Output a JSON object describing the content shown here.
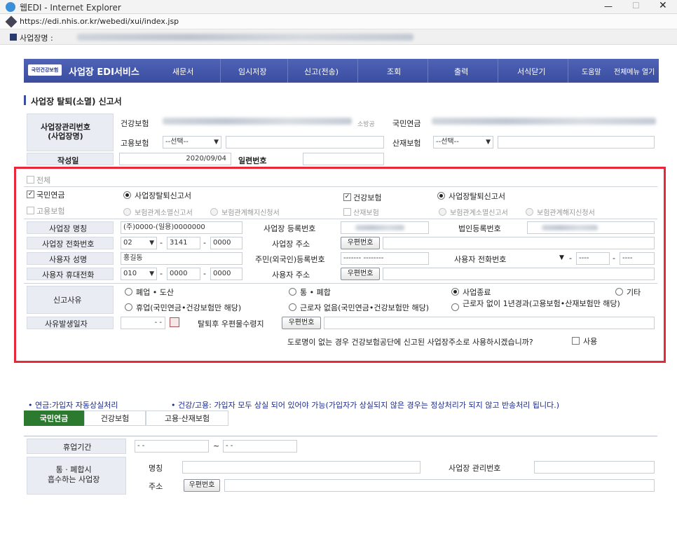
{
  "window": {
    "title": "웹EDI - Internet Explorer",
    "url": "https://edi.nhis.or.kr/webedi/xui/index.jsp"
  },
  "bizbar": {
    "label": "사업장명 :"
  },
  "nav": {
    "logo": "국민건강보험",
    "brand": "사업장 EDI서비스",
    "items": [
      "새문서",
      "임시저장",
      "신고(전송)",
      "조회",
      "출력",
      "서식닫기",
      "도움말",
      "전체메뉴 열기"
    ]
  },
  "page": {
    "title": "사업장 탈퇴(소멸) 신고서"
  },
  "header": {
    "mgmt_label": "사업장관리번호\n(사업장명)",
    "health_ins": "건강보험",
    "national_pension": "국민연금",
    "employment_ins": "고용보험",
    "industrial_ins": "산재보험",
    "select_placeholder": "--선택--",
    "created_label": "작성일",
    "created_value": "2020/09/04",
    "serial_label": "일련번호",
    "blurred_suffix": "소방공"
  },
  "form": {
    "all_label": "전체",
    "np_label": "국민연금",
    "hi_label": "건강보험",
    "ei_label": "고용보험",
    "ii_label": "산재보험",
    "opt_withdraw": "사업장탈퇴신고서",
    "opt_ins_extinct": "보험관계소멸신고서",
    "opt_ins_cancel": "보험관계해지신청서",
    "biz_name_label": "사업장 명칭",
    "biz_name_value": "(주)0000-(일용)0000000",
    "biz_reg_label": "사업장 등록번호",
    "corp_reg_label": "법인등록번호",
    "phone_label": "사업장 전화번호",
    "phone_area": "02",
    "phone_mid": "3141",
    "phone_last": "0000",
    "addr_label": "사업장 주소",
    "postcode_btn": "우편번호",
    "owner_label": "사용자 성명",
    "owner_value": "홍길동",
    "resident_label": "주민(외국인)등록번호",
    "resident_value": "------- --------",
    "owner_phone_label": "사용자 전화번호",
    "owner_phone_mid": "----",
    "owner_phone_last": "----",
    "mobile_label": "사용자 휴대전화",
    "mobile_area": "010",
    "mobile_mid": "0000",
    "mobile_last": "0000",
    "owner_addr_label": "사용자 주소",
    "reason_label": "신고사유",
    "reason_closed": "폐업 • 도산",
    "reason_merge": "통 • 폐합",
    "reason_end": "사업종료",
    "reason_etc": "기타",
    "reason_suspend": "휴업(국민연금•건강보험만 해당)",
    "reason_noworker": "근로자 없음(국민연금•건강보험만 해당)",
    "reason_noworker_year": "근로자 없이 1년경과(고용보험•산재보험만 해당)",
    "date_label": "사유발생일자",
    "date_value": "- -",
    "mail_label": "탈퇴후 우편물수령지",
    "road_question": "도로명이 없는 경우 건강보험공단에 신고된 사업장주소로 사용하시겠습니까?",
    "use_label": "사용"
  },
  "notes": {
    "pension_note": "• 연금:가입자 자동상실처리",
    "health_note": "• 건강/고용: 가입자 모두 상실 되어 있어야 가능(가입자가 상실되지 않은 경우는 정상처리가 되지 않고 반송처리 됩니다.)"
  },
  "tabs": [
    "국민연금",
    "건강보험",
    "고용·산재보험"
  ],
  "lower": {
    "suspend_period_label": "휴업기간",
    "suspend_from": "- -",
    "tilde": "~",
    "suspend_to": "- -",
    "absorb_label": "통 · 폐합시\n흡수하는 사업장",
    "name_label": "명칭",
    "mgmt_label": "사업장 관리번호",
    "address_label": "주소",
    "postcode_btn": "우편번호"
  }
}
